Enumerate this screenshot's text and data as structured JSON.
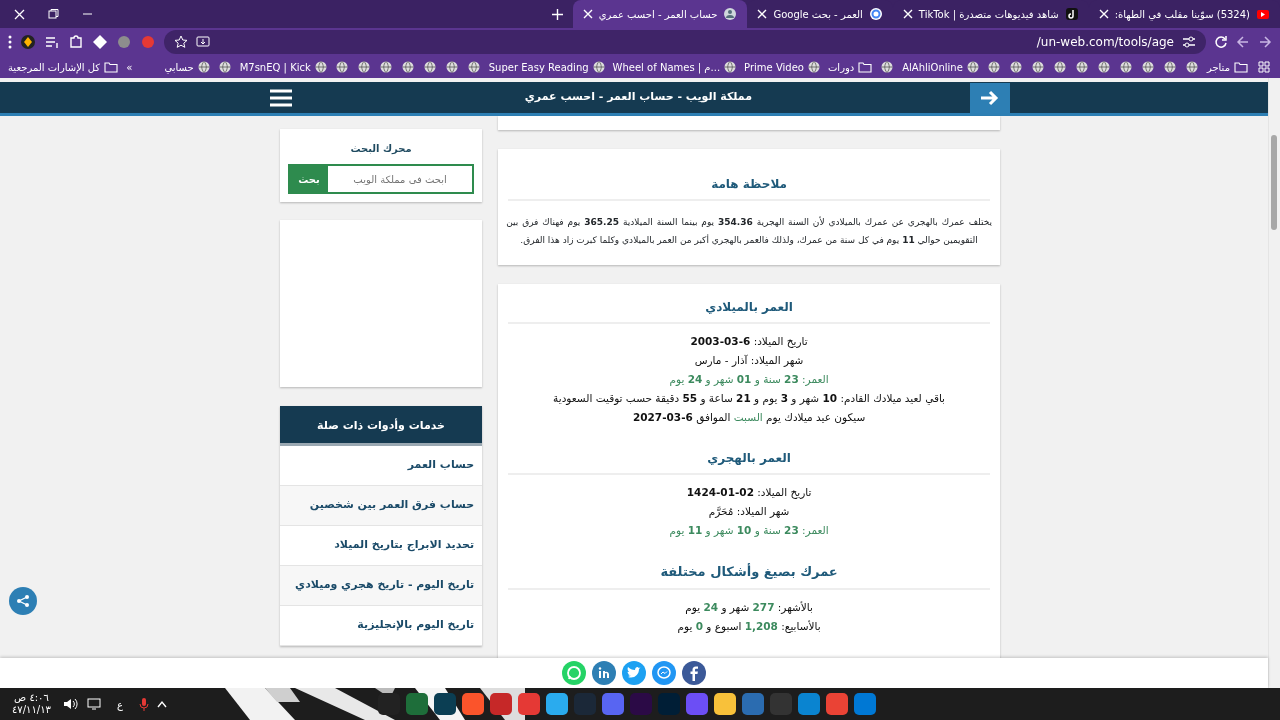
{
  "browser": {
    "tabs": [
      {
        "title": "(5324) سوّينا مقلب في الطهاة:",
        "selected": false,
        "kind": "video"
      },
      {
        "title": "TikTok | شاهد فيديوهات متصدرة",
        "selected": false,
        "kind": "note"
      },
      {
        "title": "العمر - بحث Google",
        "selected": false,
        "kind": "search"
      },
      {
        "title": "حساب العمر - احسب عمري",
        "selected": true,
        "kind": "site"
      }
    ],
    "address": "un-web.com/tools/age/",
    "bookmarks": [
      {
        "kind": "apps"
      },
      {
        "kind": "folder",
        "label": "متاجر"
      },
      {
        "kind": "icon"
      },
      {
        "kind": "icon"
      },
      {
        "kind": "icon"
      },
      {
        "kind": "icon"
      },
      {
        "kind": "icon"
      },
      {
        "kind": "icon"
      },
      {
        "kind": "icon"
      },
      {
        "kind": "icon"
      },
      {
        "kind": "icon"
      },
      {
        "kind": "icon"
      },
      {
        "kind": "site",
        "label": "AlAhliOnline"
      },
      {
        "kind": "icon"
      },
      {
        "kind": "folder",
        "label": "دورات"
      },
      {
        "kind": "site",
        "label": "Prime Video"
      },
      {
        "kind": "site",
        "label": "Wheel of Names | م..."
      },
      {
        "kind": "site",
        "label": "Super Easy Reading"
      },
      {
        "kind": "icon"
      },
      {
        "kind": "icon"
      },
      {
        "kind": "icon"
      },
      {
        "kind": "icon"
      },
      {
        "kind": "icon"
      },
      {
        "kind": "icon"
      },
      {
        "kind": "icon"
      },
      {
        "kind": "site",
        "label": "M7snEQ | Kick"
      },
      {
        "kind": "icon"
      },
      {
        "kind": "site",
        "label": "حسابي"
      }
    ],
    "overflow": "»",
    "all_bookmarks": "كل الإشارات المرجعية"
  },
  "header": {
    "title": "مملكة الويب - حساب العمر - احسب عمري"
  },
  "note": {
    "title": "ملاحظة هامة",
    "text": "يختلف عمرك بالهجري عن عمرك بالميلادي لأن السنة الهجرية **354.36** يوم بينما السنة الميلادية **365.25** يوم فهناك فرق بين التقويمين حوالي **11** يوم في كل سنة من عمرك، ولذلك فالعمر بالهجري أكبر من العمر بالميلادي وكلما كبرت زاد هذا الفرق."
  },
  "sections": [
    {
      "title": "العمر بالميلادي",
      "lines": [
        [
          {
            "text": "تاريخ الميلاد: **6-03-2003**",
            "highlight": false
          }
        ],
        [
          {
            "text": "شهر الميلاد: آذار - مارس",
            "highlight": false
          }
        ],
        [
          {
            "text": "العمر: **23** سنة و **01** شهر و **24** يوم",
            "highlight": true
          }
        ],
        [
          {
            "text": "باقي لعيد ميلادك القادم: **10** شهر و **3** يوم و **21** ساعة و **55** دقيقة حسب توقيت السعودية",
            "highlight": false
          }
        ],
        [
          {
            "text": "سيكون عيد ميلادك يوم ",
            "highlight": false
          },
          {
            "text": "السبت",
            "highlight": true
          },
          {
            "text": " الموافق **6-03-2027**",
            "highlight": false
          }
        ]
      ]
    },
    {
      "title": "العمر بالهجري",
      "lines": [
        [
          {
            "text": "تاريخ الميلاد: **02-01-1424**",
            "highlight": false
          }
        ],
        [
          {
            "text": "شهر الميلاد: مُحَرَّم",
            "highlight": false
          }
        ],
        [
          {
            "text": "العمر: **23** سنة و **10** شهر و **11** يوم",
            "highlight": true
          }
        ]
      ]
    },
    {
      "title": "عمرك بصيغ وأشكال مختلفة",
      "lines": [
        [
          {
            "text": "بالأشهر: ",
            "highlight": false
          },
          {
            "text": "**277**",
            "highlight": true
          },
          {
            "text": " شهر و ",
            "highlight": false
          },
          {
            "text": "**24**",
            "highlight": true
          },
          {
            "text": " يوم",
            "highlight": false
          }
        ],
        [
          {
            "text": "بالأسابيع: ",
            "highlight": false
          },
          {
            "text": "**1,208**",
            "highlight": true
          },
          {
            "text": " اسبوع و ",
            "highlight": false
          },
          {
            "text": "**0**",
            "highlight": true
          },
          {
            "text": " يوم",
            "highlight": false
          }
        ]
      ]
    }
  ],
  "sidebar": {
    "search": {
      "title": "محرك البحث",
      "placeholder": "ابحث في مملكة الويب",
      "button": "بحث"
    },
    "services": {
      "title": "خدمات وأدوات ذات صلة",
      "links": [
        "حساب العمر",
        "حساب فرق العمر بين شخصين",
        "تحديد الابراج بتاريخ الميلاد",
        "تاريخ اليوم - تاريخ هجري وميلادي",
        "تاريخ اليوم بالإنجليزية"
      ]
    }
  },
  "taskbar": {
    "time": "٤:٠٦ ص",
    "date": "٤٧/١١/١٣",
    "language": "ع"
  }
}
